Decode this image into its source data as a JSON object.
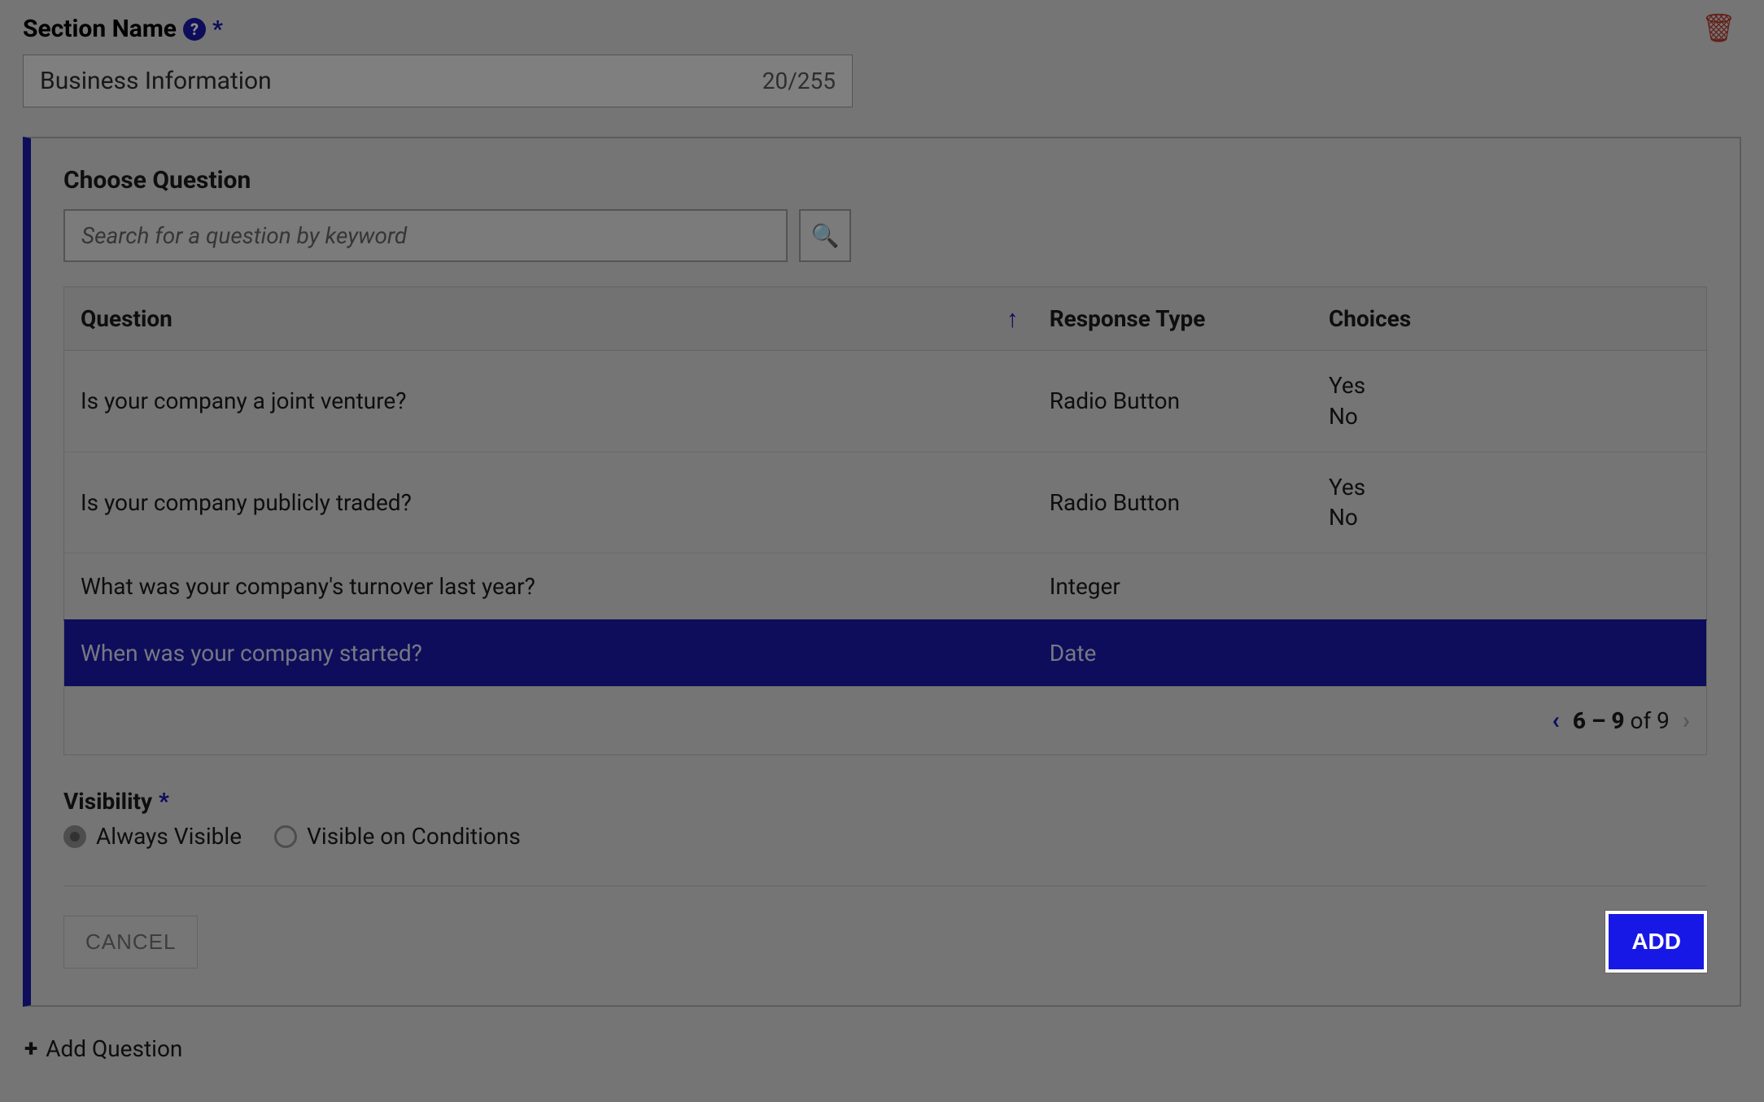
{
  "section": {
    "name_label": "Section Name",
    "required_mark": "*",
    "name_value": "Business Information",
    "char_count": "20/255"
  },
  "panel": {
    "title": "Choose Question",
    "search_placeholder": "Search for a question by keyword",
    "columns": {
      "question": "Question",
      "response_type": "Response Type",
      "choices": "Choices"
    },
    "rows": [
      {
        "question": "Is your company a joint venture?",
        "response_type": "Radio Button",
        "choices": [
          "Yes",
          "No"
        ],
        "selected": false
      },
      {
        "question": "Is your company publicly traded?",
        "response_type": "Radio Button",
        "choices": [
          "Yes",
          "No"
        ],
        "selected": false
      },
      {
        "question": "What was your company's turnover last year?",
        "response_type": "Integer",
        "choices": [],
        "selected": false
      },
      {
        "question": "When was your company started?",
        "response_type": "Date",
        "choices": [],
        "selected": true
      }
    ],
    "pager": {
      "range": "6 – 9",
      "of_word": "of",
      "total": "9"
    }
  },
  "visibility": {
    "label": "Visibility",
    "required_mark": "*",
    "options": {
      "always": "Always Visible",
      "conditional": "Visible on Conditions"
    },
    "selected": "always"
  },
  "actions": {
    "cancel": "CANCEL",
    "add": "ADD"
  },
  "add_question_link": "Add Question",
  "icons": {
    "help": "?",
    "search": "🔍",
    "trash": "🗑",
    "sort_up": "↑",
    "chev_left": "‹",
    "chev_right": "›",
    "plus": "+"
  }
}
